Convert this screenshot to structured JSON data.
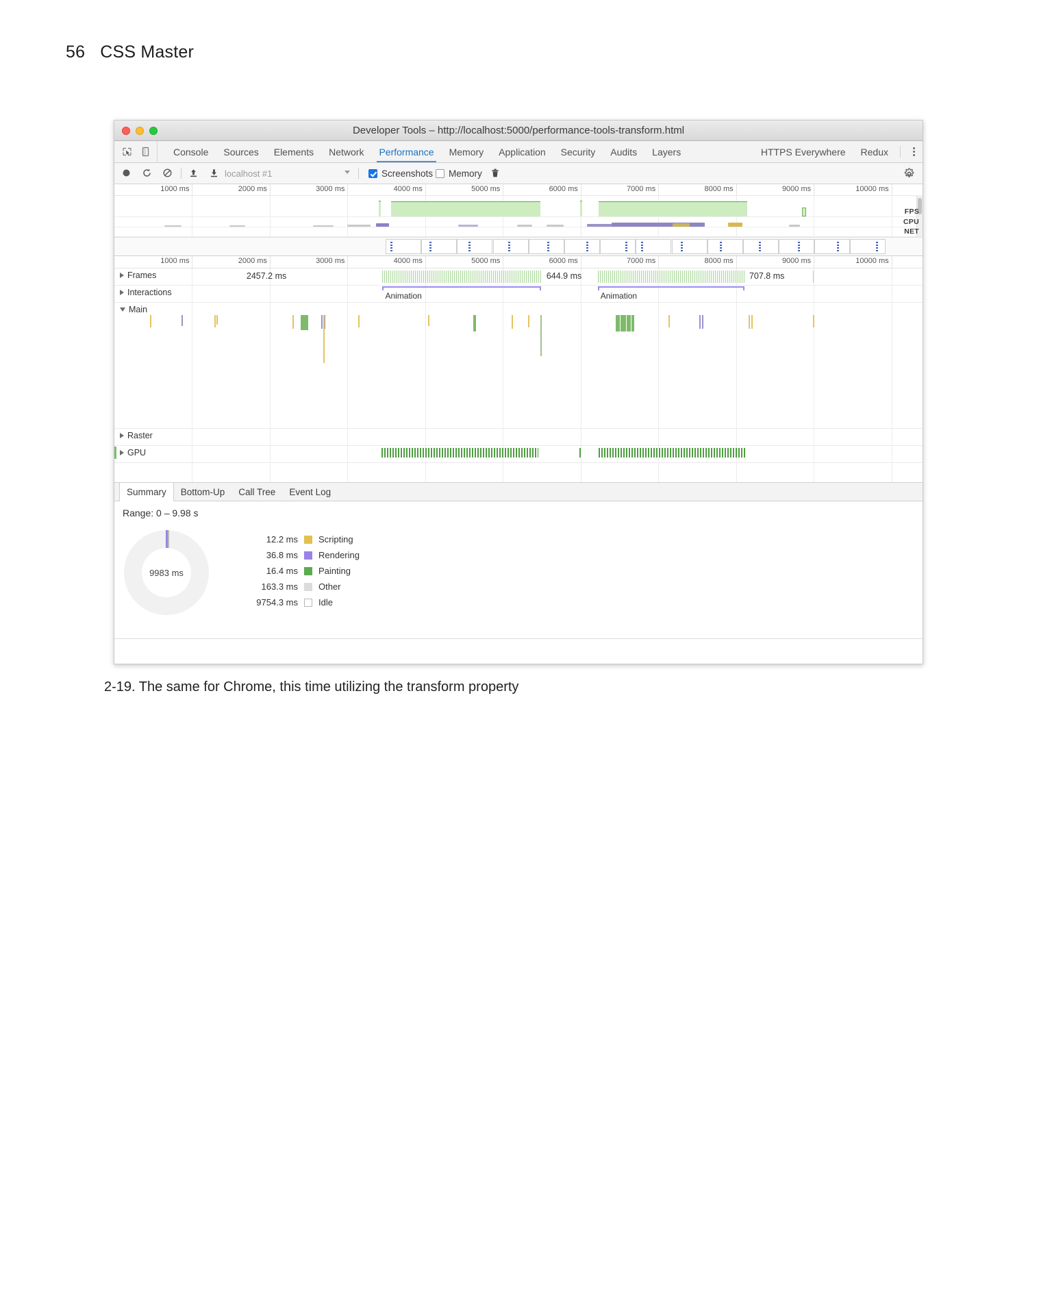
{
  "book": {
    "page_number": "56",
    "running_head": "CSS Master",
    "figure_caption": "2-19. The same for Chrome, this time utilizing the transform property"
  },
  "window": {
    "title": "Developer Tools – http://localhost:5000/performance-tools-transform.html",
    "traffic_lights": [
      "close",
      "minimize",
      "zoom"
    ]
  },
  "tabbar": {
    "left_icons": [
      "inspect-icon",
      "device-toolbar-icon"
    ],
    "tabs": [
      {
        "label": "Console",
        "active": false
      },
      {
        "label": "Sources",
        "active": false
      },
      {
        "label": "Elements",
        "active": false
      },
      {
        "label": "Network",
        "active": false
      },
      {
        "label": "Performance",
        "active": true
      },
      {
        "label": "Memory",
        "active": false
      },
      {
        "label": "Application",
        "active": false
      },
      {
        "label": "Security",
        "active": false
      },
      {
        "label": "Audits",
        "active": false
      },
      {
        "label": "Layers",
        "active": false
      }
    ],
    "extensions": [
      {
        "label": "HTTPS Everywhere"
      },
      {
        "label": "Redux"
      }
    ],
    "more_menu": "kebab-menu-icon"
  },
  "controlbar": {
    "record_icon": "record-icon",
    "reload_icon": "reload-and-record-icon",
    "clear_icon": "clear-recording-icon",
    "upload_icon": "load-profile-icon",
    "download_icon": "save-profile-icon",
    "session_value": "localhost #1",
    "session_placeholder": "localhost #1",
    "screenshots_label": "Screenshots",
    "screenshots_checked": true,
    "memory_label": "Memory",
    "memory_checked": false,
    "trash_icon": "collect-garbage-icon",
    "settings_icon": "gear-icon"
  },
  "overview": {
    "ruler_labels": [
      "1000 ms",
      "2000 ms",
      "3000 ms",
      "4000 ms",
      "5000 ms",
      "6000 ms",
      "7000 ms",
      "8000 ms",
      "9000 ms",
      "10000 ms"
    ],
    "lanes": [
      {
        "name": "FPS"
      },
      {
        "name": "CPU"
      },
      {
        "name": "NET"
      }
    ]
  },
  "flamechart": {
    "ruler_labels": [
      "1000 ms",
      "2000 ms",
      "3000 ms",
      "4000 ms",
      "5000 ms",
      "6000 ms",
      "7000 ms",
      "8000 ms",
      "9000 ms",
      "10000 ms"
    ],
    "rows": [
      {
        "label": "Frames",
        "expanded": false
      },
      {
        "label": "Interactions",
        "expanded": false
      },
      {
        "label": "Main",
        "expanded": true
      },
      {
        "label": "Raster",
        "expanded": false
      },
      {
        "label": "GPU",
        "expanded": false
      }
    ],
    "frame_durations": [
      "2457.2 ms",
      "644.9 ms",
      "707.8 ms"
    ],
    "interactions": [
      "Animation",
      "Animation"
    ]
  },
  "bottom_tabs": [
    {
      "label": "Summary",
      "active": true
    },
    {
      "label": "Bottom-Up",
      "active": false
    },
    {
      "label": "Call Tree",
      "active": false
    },
    {
      "label": "Event Log",
      "active": false
    }
  ],
  "summary": {
    "range_text": "Range: 0 – 9.98 s",
    "donut_total": "9983 ms",
    "legend": [
      {
        "value": "12.2 ms",
        "name": "Scripting",
        "color": "#e2c14e"
      },
      {
        "value": "36.8 ms",
        "name": "Rendering",
        "color": "#9a83e8"
      },
      {
        "value": "16.4 ms",
        "name": "Painting",
        "color": "#5cab52"
      },
      {
        "value": "163.3 ms",
        "name": "Other",
        "color": "#dcdcdc"
      },
      {
        "value": "9754.3 ms",
        "name": "Idle",
        "color": "#ffffff"
      }
    ]
  },
  "chart_data": {
    "type": "pie",
    "title": "Performance Summary (Range: 0 – 9.98 s)",
    "total_ms": 9983,
    "categories": [
      "Scripting",
      "Rendering",
      "Painting",
      "Other",
      "Idle"
    ],
    "values": [
      12.2,
      36.8,
      16.4,
      163.3,
      9754.3
    ],
    "unit": "ms",
    "colors": [
      "#e2c14e",
      "#9a83e8",
      "#5cab52",
      "#dcdcdc",
      "#ffffff"
    ],
    "legend": "right"
  }
}
